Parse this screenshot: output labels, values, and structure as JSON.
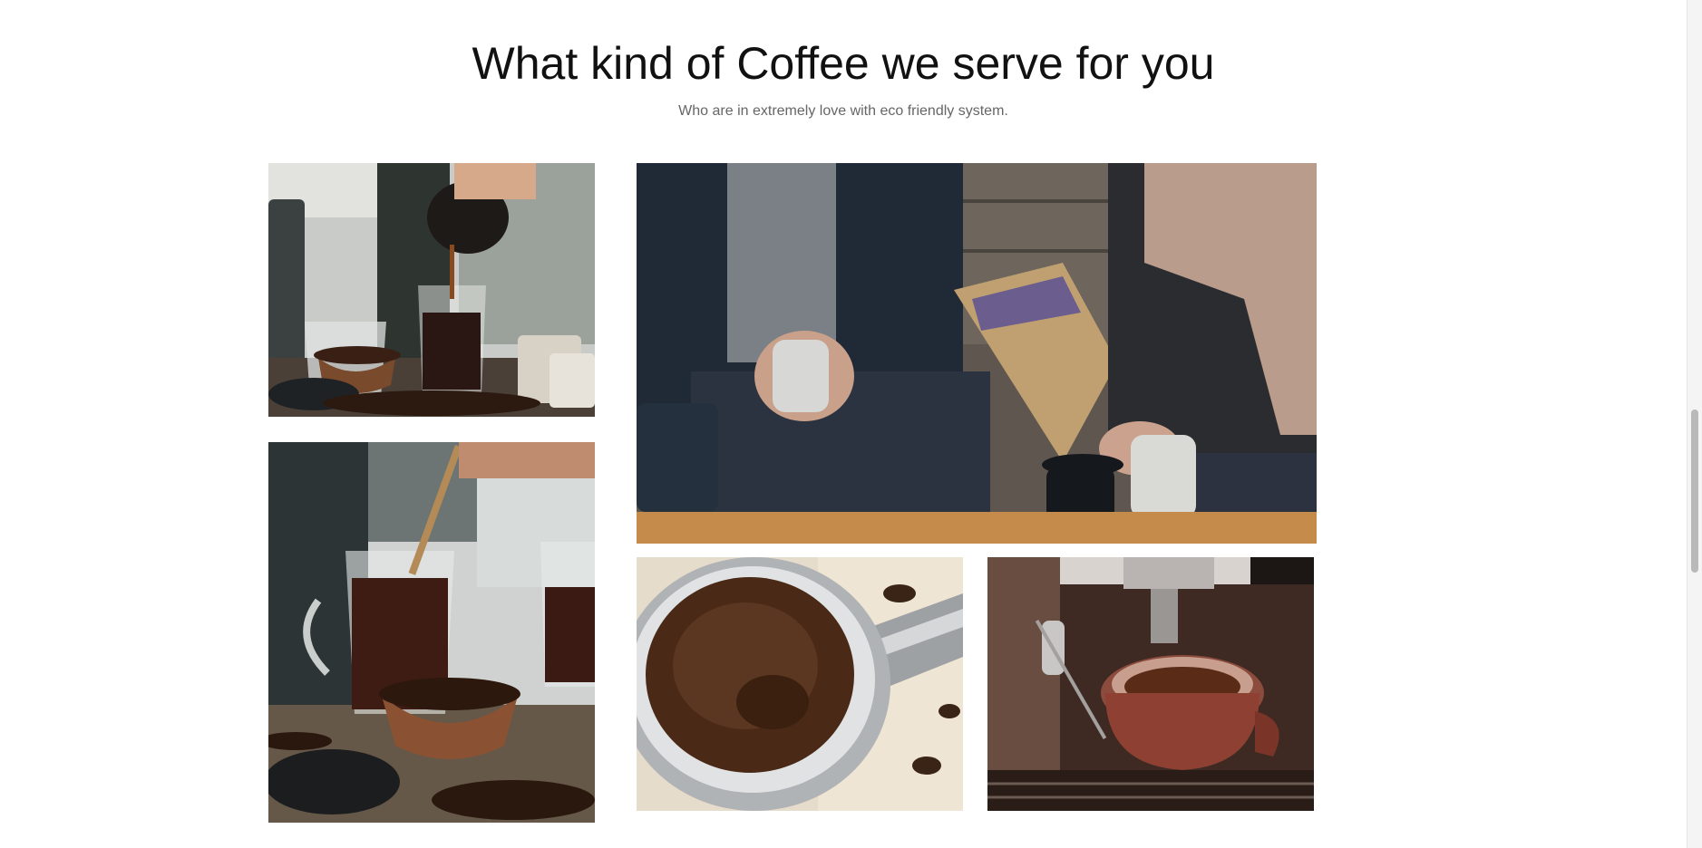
{
  "section": {
    "title": "What kind of Coffee we serve for you",
    "subtitle": "Who are in extremely love with eco friendly system."
  },
  "gallery": {
    "images": [
      {
        "alt": "Coffee being poured from a carafe into a glass mug next to a bowl of beans"
      },
      {
        "alt": "Two people sitting on a bench holding coffee mugs"
      },
      {
        "alt": "Spoon stirring black coffee in a glass mug beside a wooden bowl of beans"
      },
      {
        "alt": "Portafilter filled with ground coffee"
      },
      {
        "alt": "Espresso machine pouring coffee into a red cup"
      }
    ]
  },
  "colors": {
    "background": "#ffffff",
    "title": "#111111",
    "subtitle": "#666666"
  }
}
